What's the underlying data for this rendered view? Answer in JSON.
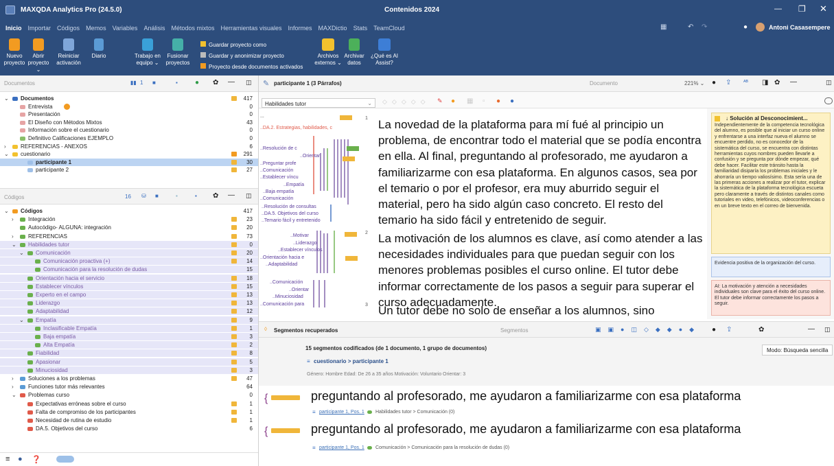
{
  "window": {
    "app_title": "MAXQDA Analytics Pro (24.5.0)",
    "project_title": "Contenidos 2024",
    "user_name": "Antoni Casasempere"
  },
  "menu": [
    "Inicio",
    "Importar",
    "Códigos",
    "Memos",
    "Variables",
    "Análisis",
    "Métodos mixtos",
    "Herramientas visuales",
    "Informes",
    "MAXDictio",
    "Stats",
    "TeamCloud"
  ],
  "ribbon": {
    "new_project_1": "Nuevo",
    "new_project_2": "proyecto",
    "open_project_1": "Abrir",
    "open_project_2": "proyecto ⌄",
    "restart_1": "Reiniciar",
    "restart_2": "activación",
    "diary": "Diario",
    "team_1": "Trabajo en",
    "team_2": "equipo ⌄",
    "merge_1": "Fusionar",
    "merge_2": "proyectos",
    "save_as": "Guardar proyecto como",
    "save_anon": "Guardar y anonimizar proyecto",
    "from_docs": "Proyecto desde documentos activados",
    "ext_1": "Archivos",
    "ext_2": "externos ⌄",
    "arch_1": "Archivar",
    "arch_2": "datos",
    "ai_1": "¿Qué es AI",
    "ai_2": "Assist?"
  },
  "doc_system": {
    "search_placeholder": "Documentos",
    "filter_count": "1",
    "rows": [
      {
        "label": "Documentos",
        "count": "417",
        "indent": 0,
        "bold": true,
        "marker": "#f0b63a",
        "expander": "⌄",
        "icon": "#3a6fc0"
      },
      {
        "label": "Entrevista",
        "count": "0",
        "indent": 1,
        "icon": "#e6a4a4",
        "badge": "#f29b21"
      },
      {
        "label": "Presentación",
        "count": "0",
        "indent": 1,
        "icon": "#e6a4a4"
      },
      {
        "label": "El Diseño con Métodos Mixtos",
        "count": "43",
        "indent": 1,
        "icon": "#e6a4a4"
      },
      {
        "label": "Información sobre el cuestionario",
        "count": "0",
        "indent": 1,
        "icon": "#e6a4a4"
      },
      {
        "label": "Definitivo Calificaciones EJEMPLO",
        "count": "0",
        "indent": 1,
        "icon": "#8abf6a"
      },
      {
        "label": "REFERENCIAS - ANEXOS",
        "count": "6",
        "indent": 0,
        "expander": "›",
        "icon": "#f2c12e",
        "pad": 1
      },
      {
        "label": "cuestionario",
        "count": "291",
        "indent": 0,
        "expander": "⌄",
        "icon": "#f2c12e",
        "pad": 1,
        "marker": "#f29b21"
      },
      {
        "label": "participante 1",
        "count": "30",
        "indent": 2,
        "bold": true,
        "icon": "#9fc0e8",
        "selected": true,
        "marker": "#f0b63a"
      },
      {
        "label": "participante 2",
        "count": "27",
        "indent": 2,
        "icon": "#9fc0e8",
        "marker": "#f0b63a"
      }
    ]
  },
  "code_system": {
    "search_placeholder": "Códigos",
    "filter_count": "16",
    "rows": [
      {
        "label": "Códigos",
        "count": "417",
        "indent": 0,
        "bold": true,
        "expander": "⌄",
        "icon": "#f29b21"
      },
      {
        "label": "Integración",
        "count": "23",
        "indent": 1,
        "expander": "›",
        "icon": "#6ab04c",
        "marker": "#f0b63a"
      },
      {
        "label": "Autocódigo- ALGUNA: integración",
        "count": "20",
        "indent": 1,
        "icon": "#6ab04c",
        "marker": "#f0b63a"
      },
      {
        "label": "REFERENCIAS",
        "count": "73",
        "indent": 1,
        "expander": "›",
        "icon": "#6ab04c",
        "marker": "#f0b63a"
      },
      {
        "label": "Habilidades tutor",
        "count": "0",
        "indent": 1,
        "expander": "⌄",
        "icon": "#6ab04c",
        "selected": true,
        "marker": "#f0b63a",
        "color": "#7b5ca6"
      },
      {
        "label": "Comunicación",
        "count": "20",
        "indent": 2,
        "expander": "⌄",
        "icon": "#6ab04c",
        "selected": true,
        "marker": "#f0b63a",
        "color": "#7b5ca6"
      },
      {
        "label": "Comunicación proactiva (+)",
        "count": "14",
        "indent": 3,
        "icon": "#6ab04c",
        "selected": true,
        "marker": "#f0b63a",
        "color": "#7b5ca6"
      },
      {
        "label": "Comunicación para la resolución de dudas",
        "count": "15",
        "indent": 3,
        "icon": "#6ab04c",
        "selected": true,
        "color": "#7b5ca6"
      },
      {
        "label": "Orientación hacia el servicio",
        "count": "18",
        "indent": 2,
        "icon": "#6ab04c",
        "selected": true,
        "marker": "#f0b63a",
        "color": "#7b5ca6"
      },
      {
        "label": "Establecer vínculos",
        "count": "15",
        "indent": 2,
        "icon": "#6ab04c",
        "selected": true,
        "marker": "#f0b63a",
        "color": "#7b5ca6"
      },
      {
        "label": "Experto en el campo",
        "count": "13",
        "indent": 2,
        "icon": "#6ab04c",
        "selected": true,
        "marker": "#f0b63a",
        "color": "#7b5ca6"
      },
      {
        "label": "Liderazgo",
        "count": "13",
        "indent": 2,
        "icon": "#6ab04c",
        "selected": true,
        "marker": "#f0b63a",
        "color": "#7b5ca6"
      },
      {
        "label": "Adaptabilidad",
        "count": "12",
        "indent": 2,
        "icon": "#6ab04c",
        "selected": true,
        "marker": "#f0b63a",
        "color": "#7b5ca6"
      },
      {
        "label": "Empatía",
        "count": "9",
        "indent": 2,
        "expander": "⌄",
        "icon": "#6ab04c",
        "selected": true,
        "marker": "#f0b63a",
        "color": "#7b5ca6"
      },
      {
        "label": "Inclasificable Empatía",
        "count": "1",
        "indent": 3,
        "icon": "#6ab04c",
        "selected": true,
        "marker": "#f0b63a",
        "color": "#7b5ca6"
      },
      {
        "label": "Baja empatía",
        "count": "3",
        "indent": 3,
        "icon": "#6ab04c",
        "selected": true,
        "marker": "#f0b63a",
        "color": "#7b5ca6"
      },
      {
        "label": "Alta Empatía",
        "count": "2",
        "indent": 3,
        "icon": "#6ab04c",
        "selected": true,
        "marker": "#f0b63a",
        "color": "#7b5ca6"
      },
      {
        "label": "Fiabilidad",
        "count": "8",
        "indent": 2,
        "icon": "#6ab04c",
        "selected": true,
        "marker": "#f0b63a",
        "color": "#7b5ca6"
      },
      {
        "label": "Apasionar",
        "count": "5",
        "indent": 2,
        "icon": "#6ab04c",
        "selected": true,
        "marker": "#f0b63a",
        "color": "#7b5ca6"
      },
      {
        "label": "Minuciosidad",
        "count": "3",
        "indent": 2,
        "icon": "#6ab04c",
        "selected": true,
        "marker": "#f0b63a",
        "color": "#7b5ca6"
      },
      {
        "label": "Soluciones a los problemas",
        "count": "47",
        "indent": 1,
        "expander": "›",
        "icon": "#5b9bd5",
        "marker": "#f0b63a"
      },
      {
        "label": "Funciones tutor más relevantes",
        "count": "64",
        "indent": 1,
        "expander": "›",
        "icon": "#5b9bd5"
      },
      {
        "label": "Problemas curso",
        "count": "0",
        "indent": 1,
        "expander": "⌄",
        "icon": "#e05a4a"
      },
      {
        "label": "Expectativas erróneas sobre el curso",
        "count": "1",
        "indent": 2,
        "icon": "#e05a4a",
        "marker": "#f0b63a"
      },
      {
        "label": "Falta de compromiso de los participantes",
        "count": "1",
        "indent": 2,
        "icon": "#e05a4a",
        "marker": "#f0b63a"
      },
      {
        "label": "Necesidad de rutina de estudio",
        "count": "1",
        "indent": 2,
        "icon": "#e05a4a",
        "marker": "#f0b63a"
      },
      {
        "label": "DA.5. Objetivos del curso",
        "count": "6",
        "indent": 2,
        "icon": "#e05a4a"
      }
    ]
  },
  "browser": {
    "doc_title": "participante 1   (3 Párrafos)",
    "search_placeholder": "Documento",
    "zoom": "221% ⌄",
    "code_select": "Habilidades tutor",
    "paragraph_1": "La novedad de la plataforma para mí fué al principio un problema, de encontrar todo el material que se podía encontra en ella. Al final, preguntando al profesorado, me ayudaron a familiarizarme con esa plataforma. En algunos casos, sea por el temario o por el profesor, era muy aburrido seguir el material, pero ha sido algún caso concreto. El resto del temario ha sido fácil y entretenido de seguir.",
    "paragraph_2": "La motivación de los alumnos es clave, así como atender a las necesidades individuales para que puedan seguir con los menores problemas posibles el curso online. El tutor debe informar correctamente de los pasos a seguir para superar el curso adecuadamente.",
    "paragraph_3": "Un tutor debe no solo de enseñar a los alumnos, sino",
    "stripe_labels": [
      "...",
      "..DA.2. Estrategias, habilidades, c",
      "..Resolución de c",
      "..Orientar",
      "..Preguntar profe",
      "..Comunicación",
      "..Establecer víncu",
      "..Empatía",
      "..Baja empatía",
      "..Comunicación",
      "..Resolución de consultas",
      "..DA.5. Objetivos del curso",
      "..Temario fácil y entretenido",
      "..Motivar",
      "..Liderazgo",
      "..Establecer vínculos",
      "..Orientación hacia e",
      "..Adaptabilidad",
      "..Comunicación",
      "..Orientar",
      "..Minuciosidad",
      "..Comunicación para"
    ],
    "paragraph_numbers": [
      "1",
      "2",
      "3"
    ]
  },
  "memos": {
    "memo_1_title": "↓ Solución al Desconocimient...",
    "memo_1_text": "Independientemente de la competencia tecnológica del alumno, es posible que al iniciar un curso online y enfrentarse a una interfaz nueva el alumno se encuentre perdido, no es conocedor de la sistemática del curso, se encuentra con distintas herramientas cuyos nombres pueden llevarle a confusión y se pregunta por dónde empezar, qué debe hacer. Facilitar este tránsito hasta la familiaridad disiparía los problemas iniciales y le ahorraría un tiempo valiosísimo. Esta sería una de las primeras acciones a realizar por el tutor, explicar la sistemática de la plataforma tecnológica escueta pero claramente a través de distintos canales como tutoriales en video, telefónicos, videoconferencias o en un breve texto en el correo de bienvenida.",
    "memo_2_text": "Evidencia positiva de la organización del curso.",
    "memo_3_text": "AI: La motivación y atención a necesidades individuales son clave para el éxito del curso online. El tutor debe informar correctamente los pasos a seguir."
  },
  "retrieval": {
    "title": "Segmentos recuperados",
    "search_placeholder": "Segmentos",
    "summary": "15 segmentos codificados (de 1 documento, 1 grupo de documentos)",
    "doc_path": "cuestionario > participante 1",
    "variables": "Género: Hombre   Edad: De 26 a 35 años   Motivación: Voluntario   Orientar: 3",
    "mode": "Modo: Búsqueda sencilla",
    "segments": [
      {
        "text": "preguntando al profesorado, me ayudaron a familiarizarme con esa plataforma",
        "source": "participante 1, Pos. 1",
        "code": "Habilidades tutor > Comunicación (0)"
      },
      {
        "text": "preguntando al profesorado, me ayudaron a familiarizarme con esa plataforma",
        "source": "participante 1, Pos. 1",
        "code": "Comunicación > Comunicación para la resolución de dudas (0)"
      }
    ]
  }
}
